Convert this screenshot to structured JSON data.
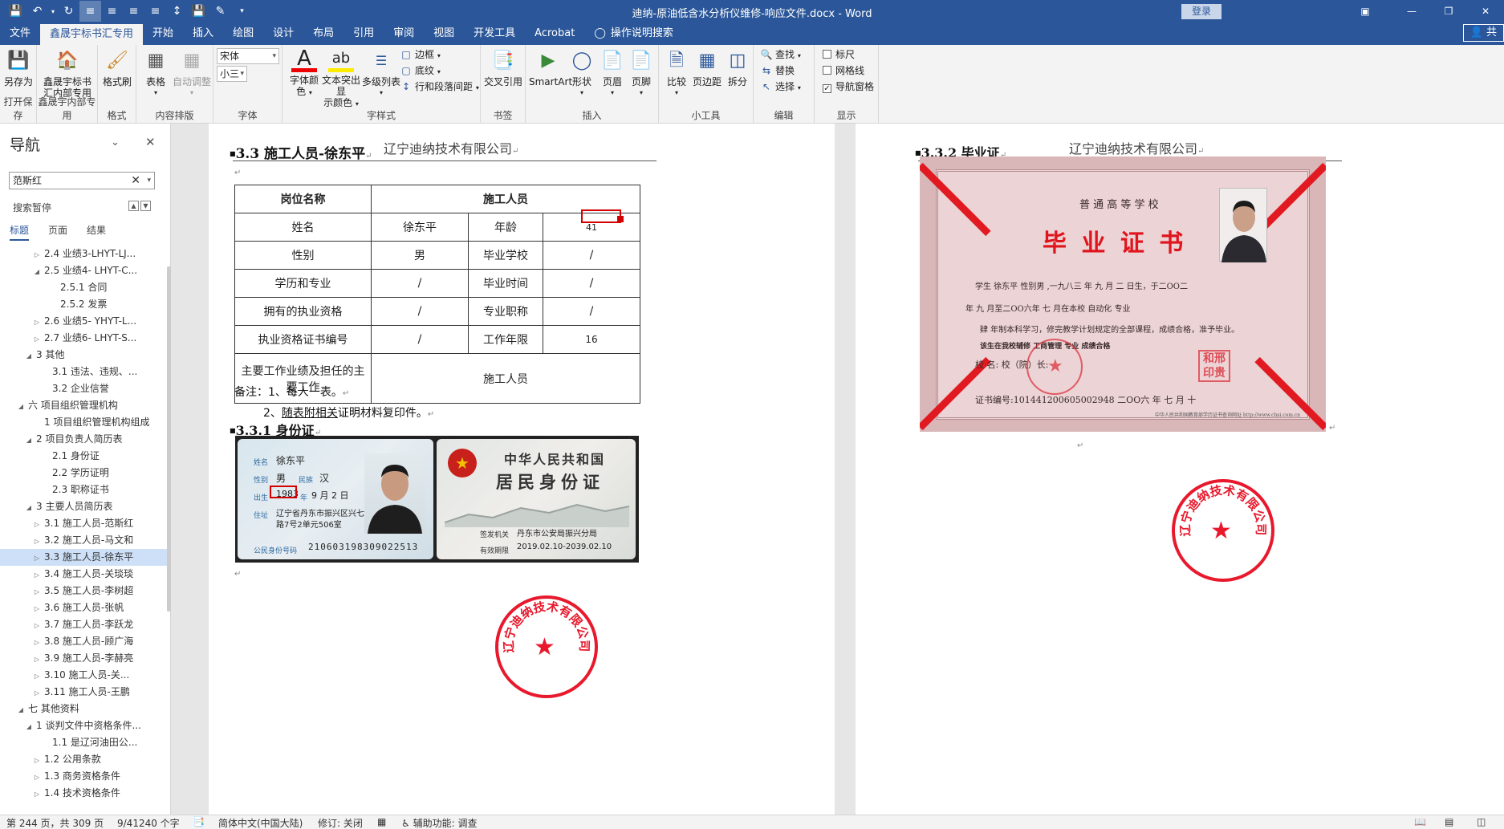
{
  "window": {
    "title": "迪纳-原油低含水分析仪维修-响应文件.docx  -  Word",
    "login_label": "登录",
    "share_label": "共"
  },
  "tabs": [
    {
      "label": "文件",
      "active": false
    },
    {
      "label": "鑫晟宇标书汇专用",
      "active": true
    },
    {
      "label": "开始",
      "active": false
    },
    {
      "label": "插入",
      "active": false
    },
    {
      "label": "绘图",
      "active": false
    },
    {
      "label": "设计",
      "active": false
    },
    {
      "label": "布局",
      "active": false
    },
    {
      "label": "引用",
      "active": false
    },
    {
      "label": "审阅",
      "active": false
    },
    {
      "label": "视图",
      "active": false
    },
    {
      "label": "开发工具",
      "active": false
    },
    {
      "label": "Acrobat",
      "active": false
    },
    {
      "label": "操作说明搜索",
      "active": false
    }
  ],
  "ribbon": {
    "save_as": "另存为",
    "group_open_save": "打开保存",
    "xsy_btn_line1": "鑫晟宇标书",
    "xsy_btn_line2": "汇内部专用",
    "group_xsy": "鑫晟宇内部专用",
    "format_painter": "格式刷",
    "group_format": "格式",
    "table_btn": "表格",
    "auto_adjust": "自动调整",
    "group_layout": "内容排版",
    "font_name": "宋体",
    "font_size": "小三",
    "group_font": "字体",
    "font_color_line1": "字体颜",
    "font_color_line2": "色",
    "highlight_line1": "文本突出显",
    "highlight_line2": "示颜色",
    "multilevel": "多级列表",
    "border": "边框",
    "shading": "底纹",
    "spacing": "行和段落间距",
    "group_style": "字样式",
    "cross_ref": "交叉引用",
    "group_bookmark": "书签",
    "smartart": "SmartArt",
    "shape": "形状",
    "header": "页眉",
    "footer": "页脚",
    "group_insert": "插入",
    "compare": "比较",
    "page_margin": "页边距",
    "split": "拆分",
    "group_tools": "小工具",
    "find": "查找",
    "replace": "替换",
    "select": "选择",
    "group_edit": "编辑",
    "ruler": "标尺",
    "gridlines": "网格线",
    "nav_pane": "导航窗格",
    "group_show": "显示"
  },
  "nav": {
    "title": "导航",
    "search_value": "范斯红",
    "paused": "搜索暂停",
    "tabs": [
      "标题",
      "页面",
      "结果"
    ],
    "items": [
      {
        "text": "2.4 业绩3-LHYT-LJ...",
        "indent": 3,
        "tw": "right",
        "sel": false
      },
      {
        "text": "2.5 业绩4- LHYT-C...",
        "indent": 3,
        "tw": "down",
        "sel": false
      },
      {
        "text": "2.5.1 合同",
        "indent": 5,
        "tw": "",
        "sel": false
      },
      {
        "text": "2.5.2 发票",
        "indent": 5,
        "tw": "",
        "sel": false
      },
      {
        "text": "2.6 业绩5- YHYT-L...",
        "indent": 3,
        "tw": "right",
        "sel": false
      },
      {
        "text": "2.7 业绩6- LHYT-S...",
        "indent": 3,
        "tw": "right",
        "sel": false
      },
      {
        "text": "3 其他",
        "indent": 2,
        "tw": "down",
        "sel": false
      },
      {
        "text": "3.1 违法、违规、...",
        "indent": 4,
        "tw": "",
        "sel": false
      },
      {
        "text": "3.2 企业信誉",
        "indent": 4,
        "tw": "",
        "sel": false
      },
      {
        "text": "六 项目组织管理机构",
        "indent": 1,
        "tw": "down",
        "sel": false
      },
      {
        "text": "1 项目组织管理机构组成",
        "indent": 3,
        "tw": "",
        "sel": false
      },
      {
        "text": "2 项目负责人简历表",
        "indent": 2,
        "tw": "down",
        "sel": false
      },
      {
        "text": "2.1 身份证",
        "indent": 4,
        "tw": "",
        "sel": false
      },
      {
        "text": "2.2 学历证明",
        "indent": 4,
        "tw": "",
        "sel": false
      },
      {
        "text": "2.3 职称证书",
        "indent": 4,
        "tw": "",
        "sel": false
      },
      {
        "text": "3 主要人员简历表",
        "indent": 2,
        "tw": "down",
        "sel": false
      },
      {
        "text": "3.1 施工人员-范斯红",
        "indent": 3,
        "tw": "right",
        "sel": false
      },
      {
        "text": "3.2 施工人员-马文和",
        "indent": 3,
        "tw": "right",
        "sel": false
      },
      {
        "text": "3.3 施工人员-徐东平",
        "indent": 3,
        "tw": "right",
        "sel": true
      },
      {
        "text": "3.4 施工人员-关琰琰",
        "indent": 3,
        "tw": "right",
        "sel": false
      },
      {
        "text": "3.5 施工人员-李树超",
        "indent": 3,
        "tw": "right",
        "sel": false
      },
      {
        "text": "3.6 施工人员-张帆",
        "indent": 3,
        "tw": "right",
        "sel": false
      },
      {
        "text": "3.7 施工人员-李跃龙",
        "indent": 3,
        "tw": "right",
        "sel": false
      },
      {
        "text": "3.8 施工人员-顾广海",
        "indent": 3,
        "tw": "right",
        "sel": false
      },
      {
        "text": "3.9 施工人员-李赫亮",
        "indent": 3,
        "tw": "right",
        "sel": false
      },
      {
        "text": "3.10 施工人员-关...",
        "indent": 3,
        "tw": "right",
        "sel": false
      },
      {
        "text": "3.11 施工人员-王鹏",
        "indent": 3,
        "tw": "right",
        "sel": false
      },
      {
        "text": "七 其他资料",
        "indent": 1,
        "tw": "down",
        "sel": false
      },
      {
        "text": "1 谈判文件中资格条件...",
        "indent": 2,
        "tw": "down",
        "sel": false
      },
      {
        "text": "1.1 是辽河油田公...",
        "indent": 4,
        "tw": "",
        "sel": false
      },
      {
        "text": "1.2 公用条款",
        "indent": 3,
        "tw": "right",
        "sel": false
      },
      {
        "text": "1.3 商务资格条件",
        "indent": 3,
        "tw": "right",
        "sel": false
      },
      {
        "text": "1.4 技术资格条件",
        "indent": 3,
        "tw": "right",
        "sel": false
      }
    ]
  },
  "page1": {
    "header": "辽宁迪纳技术有限公司",
    "heading": "3.3   施工人员-徐东平",
    "table": {
      "h_position": "岗位名称",
      "h_worker": "施工人员",
      "name_lbl": "姓名",
      "name_val": "徐东平",
      "age_lbl": "年龄",
      "age_val": "41",
      "sex_lbl": "性别",
      "sex_val": "男",
      "school_lbl": "毕业学校",
      "school_val": "/",
      "edu_lbl": "学历和专业",
      "edu_val": "/",
      "gradtime_lbl": "毕业时间",
      "gradtime_val": "/",
      "qual_lbl": "拥有的执业资格",
      "qual_val": "/",
      "title_lbl": "专业职称",
      "title_val": "/",
      "cert_lbl": "执业资格证书编号",
      "cert_val": "/",
      "years_lbl": "工作年限",
      "years_val": "16",
      "main_lbl": "主要工作业绩及担任的主要工作",
      "main_val": "施工人员"
    },
    "note1": "备注：1、每人一表。",
    "note2_prefix": "2、",
    "note2_underlined": "随表附相关",
    "note2_suffix": "证明材料复印件。",
    "heading_id": "3.3.1  身份证",
    "id_front": {
      "name_lbl": "姓名",
      "name": "徐东平",
      "sex_lbl": "性别",
      "sex": "男",
      "ethnic_lbl": "民族",
      "ethnic": "汉",
      "birth_lbl": "出生",
      "birth_year": "1983",
      "year_char": "年",
      "birth_md": "9 月 2 日",
      "addr_lbl": "住址",
      "addr1": "辽宁省丹东市振兴区兴七",
      "addr2": "路7号2单元506室",
      "num_lbl": "公民身份号码",
      "number": "210603198309022513"
    },
    "id_back": {
      "title1": "中华人民共和国",
      "title2": "居民身份证",
      "issuer_lbl": "签发机关",
      "issuer": "丹东市公安局振兴分局",
      "valid_lbl": "有效期限",
      "valid": "2019.02.10-2039.02.10"
    },
    "seal_text": "辽宁迪纳技术有限公司"
  },
  "page2": {
    "header": "辽宁迪纳技术有限公司",
    "heading": "3.3.2  毕业证",
    "cert": {
      "school_type": "普 通 高 等 学 校",
      "title": "毕 业 证 书",
      "line1": "学生      徐东平   性别男  ,一九八三 年 九 月  二  日生，于二OO二",
      "line2": "年  九 月至二OO六年  七  月在本校                   自动化              专业",
      "line3": "肄 年制本科学习，修完教学计划规定的全部课程，成绩合格，准予毕业。",
      "line4": "该生在我校辅修          工商管理          专业          成绩合格",
      "line5": "校     名:                                     校（院）长:",
      "line6": "证书编号:101441200605002948              二OO六 年  七  月  十",
      "footer": "中华人民共和国教育部学历证书查询网址 http://www.chsi.com.cn",
      "stamp_text": "和邢印贵"
    },
    "seal_text": "辽宁迪纳技术有限公司"
  },
  "status": {
    "page": "第 244 页，共 309 页",
    "words": "9/41240 个字",
    "lang": "简体中文(中国大陆)",
    "track": "修订: 关闭",
    "access": "辅助功能: 调查"
  }
}
